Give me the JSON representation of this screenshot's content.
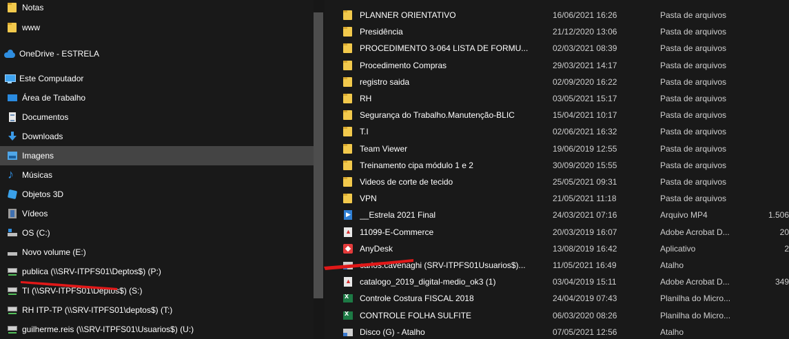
{
  "nav": {
    "items": [
      {
        "label": "Notas",
        "icon": "folder-icon"
      },
      {
        "label": "www",
        "icon": "folder-icon"
      },
      {
        "label": "OneDrive - ESTRELA",
        "icon": "onedrive-icon"
      },
      {
        "label": "Este Computador",
        "icon": "computer-icon"
      },
      {
        "label": "Área de Trabalho",
        "icon": "desktop-icon"
      },
      {
        "label": "Documentos",
        "icon": "documents-icon"
      },
      {
        "label": "Downloads",
        "icon": "downloads-icon"
      },
      {
        "label": "Imagens",
        "icon": "pictures-icon",
        "selected": true
      },
      {
        "label": "Músicas",
        "icon": "music-icon"
      },
      {
        "label": "Objetos 3D",
        "icon": "3d-objects-icon"
      },
      {
        "label": "Vídeos",
        "icon": "videos-icon"
      },
      {
        "label": "OS (C:)",
        "icon": "os-drive-icon"
      },
      {
        "label": "Novo volume (E:)",
        "icon": "drive-icon"
      },
      {
        "label": "publica (\\\\SRV-ITPFS01\\Deptos$) (P:)",
        "icon": "network-drive-icon"
      },
      {
        "label": "TI (\\\\SRV-ITPFS01\\Deptos$) (S:)",
        "icon": "network-drive-icon"
      },
      {
        "label": "RH ITP-TP (\\\\SRV-ITPFS01\\deptos$) (T:)",
        "icon": "network-drive-icon"
      },
      {
        "label": "guilherme.reis (\\\\SRV-ITPFS01\\Usuarios$) (U:)",
        "icon": "network-drive-icon"
      }
    ]
  },
  "files": [
    {
      "name": "PLANNER ORIENTATIVO",
      "date": "16/06/2021 16:26",
      "type": "Pasta de arquivos",
      "size": "",
      "icon": "folder-icon"
    },
    {
      "name": "Presidência",
      "date": "21/12/2020 13:06",
      "type": "Pasta de arquivos",
      "size": "",
      "icon": "folder-icon"
    },
    {
      "name": "PROCEDIMENTO 3-064 LISTA DE FORMU...",
      "date": "02/03/2021 08:39",
      "type": "Pasta de arquivos",
      "size": "",
      "icon": "folder-icon"
    },
    {
      "name": "Procedimento Compras",
      "date": "29/03/2021 14:17",
      "type": "Pasta de arquivos",
      "size": "",
      "icon": "folder-icon"
    },
    {
      "name": "registro saida",
      "date": "02/09/2020 16:22",
      "type": "Pasta de arquivos",
      "size": "",
      "icon": "folder-icon"
    },
    {
      "name": "RH",
      "date": "03/05/2021 15:17",
      "type": "Pasta de arquivos",
      "size": "",
      "icon": "folder-icon"
    },
    {
      "name": "Segurança do Trabalho.Manutenção-BLIC",
      "date": "15/04/2021 10:17",
      "type": "Pasta de arquivos",
      "size": "",
      "icon": "folder-icon"
    },
    {
      "name": "T.I",
      "date": "02/06/2021 16:32",
      "type": "Pasta de arquivos",
      "size": "",
      "icon": "folder-icon"
    },
    {
      "name": "Team Viewer",
      "date": "19/06/2019 12:55",
      "type": "Pasta de arquivos",
      "size": "",
      "icon": "folder-icon"
    },
    {
      "name": "Treinamento cipa módulo 1 e 2",
      "date": "30/09/2020 15:55",
      "type": "Pasta de arquivos",
      "size": "",
      "icon": "folder-icon"
    },
    {
      "name": "Videos de corte de tecido",
      "date": "25/05/2021 09:31",
      "type": "Pasta de arquivos",
      "size": "",
      "icon": "folder-icon"
    },
    {
      "name": "VPN",
      "date": "21/05/2021 11:18",
      "type": "Pasta de arquivos",
      "size": "",
      "icon": "folder-icon"
    },
    {
      "name": "__Estrela 2021 Final",
      "date": "24/03/2021 07:16",
      "type": "Arquivo MP4",
      "size": "1.506",
      "icon": "mp4-file-icon"
    },
    {
      "name": "11099-E-Commerce",
      "date": "20/03/2019 16:07",
      "type": "Adobe Acrobat D...",
      "size": "20",
      "icon": "pdf-file-icon"
    },
    {
      "name": "AnyDesk",
      "date": "13/08/2019 16:42",
      "type": "Aplicativo",
      "size": "2",
      "icon": "anydesk-app-icon"
    },
    {
      "name": "carlos.cavenaghi (SRV-ITPFS01Usuarios$)...",
      "date": "11/05/2021 16:49",
      "type": "Atalho",
      "size": "",
      "icon": "shortcut-icon"
    },
    {
      "name": "catalogo_2019_digital-medio_ok3 (1)",
      "date": "03/04/2019 15:11",
      "type": "Adobe Acrobat D...",
      "size": "349",
      "icon": "pdf-file-icon"
    },
    {
      "name": "Controle Costura FISCAL 2018",
      "date": "24/04/2019 07:43",
      "type": "Planilha do Micro...",
      "size": "",
      "icon": "excel-file-icon"
    },
    {
      "name": "CONTROLE FOLHA SULFITE",
      "date": "06/03/2020 08:26",
      "type": "Planilha do Micro...",
      "size": "",
      "icon": "excel-file-icon"
    },
    {
      "name": "Disco (G) - Atalho",
      "date": "07/05/2021 12:56",
      "type": "Atalho",
      "size": "",
      "icon": "shortcut-icon"
    }
  ],
  "colors": {
    "background": "#191919",
    "selected": "#444444",
    "annotation_arrow": "#e01818"
  }
}
